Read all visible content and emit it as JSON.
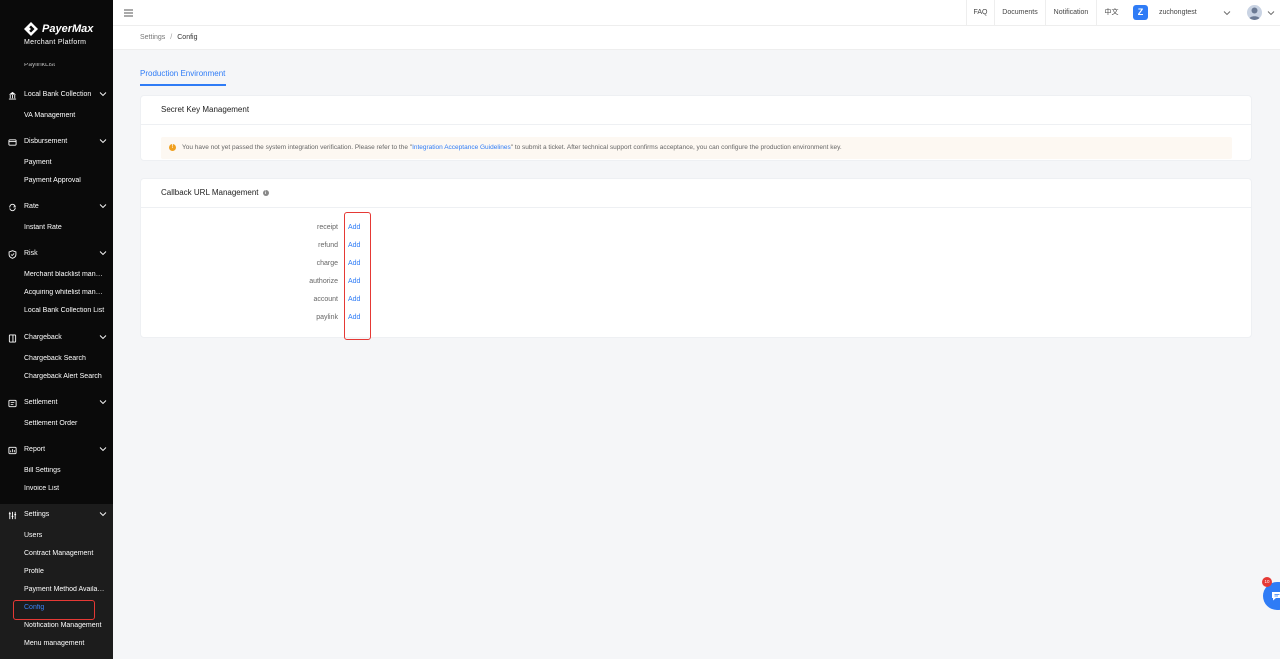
{
  "brand": {
    "name": "PayerMax",
    "subtitle": "Merchant   Platform"
  },
  "sidebar": {
    "clipped_item": "PaylinkList",
    "groups": [
      {
        "label": "Local Bank Collection",
        "icon": "bank-icon",
        "items": [
          "VA Management"
        ]
      },
      {
        "label": "Disbursement",
        "icon": "disbursement-icon",
        "items": [
          "Payment",
          "Payment Approval"
        ]
      },
      {
        "label": "Rate",
        "icon": "rate-icon",
        "items": [
          "Instant Rate"
        ]
      },
      {
        "label": "Risk",
        "icon": "shield-icon",
        "items": [
          "Merchant blacklist management",
          "Acquiring whitelist management",
          "Local Bank Collection List"
        ]
      },
      {
        "label": "Chargeback",
        "icon": "chargeback-icon",
        "items": [
          "Chargeback Search",
          "Chargeback Alert Search"
        ]
      },
      {
        "label": "Settlement",
        "icon": "settlement-icon",
        "items": [
          "Settlement Order"
        ]
      },
      {
        "label": "Report",
        "icon": "report-icon",
        "items": [
          "Bill Settings",
          "Invoice List"
        ]
      },
      {
        "label": "Settings",
        "icon": "sliders-icon",
        "items": [
          "Users",
          "Contract Management",
          "Profile",
          "Payment Method Availability",
          "Config",
          "Notification Management",
          "Menu management"
        ]
      }
    ],
    "active_item": "Config"
  },
  "topbar": {
    "links": [
      "FAQ",
      "Documents",
      "Notification",
      "中文"
    ],
    "avatar_letter": "Z",
    "username": "zuchongtest"
  },
  "breadcrumb": {
    "parent": "Settings",
    "separator": "/",
    "current": "Config"
  },
  "tab": {
    "label": "Production Environment"
  },
  "secret_key": {
    "title": "Secret Key Management",
    "notice_before": "You have not yet passed the system integration verification. Please refer to the \"",
    "notice_link": "Integration Acceptance Guidelines",
    "notice_after": "\" to submit a ticket. After technical support confirms acceptance, you can configure the production environment key."
  },
  "callback": {
    "title": "Callback URL Management",
    "rows": [
      {
        "label": "receipt",
        "action": "Add"
      },
      {
        "label": "refund",
        "action": "Add"
      },
      {
        "label": "charge",
        "action": "Add"
      },
      {
        "label": "authorize",
        "action": "Add"
      },
      {
        "label": "account",
        "action": "Add"
      },
      {
        "label": "paylink",
        "action": "Add"
      }
    ]
  },
  "help": {
    "badge": "10"
  },
  "colors": {
    "accent": "#2f7cf6",
    "sidebar_bg": "#0a0a0a",
    "highlight": "#e53935"
  }
}
